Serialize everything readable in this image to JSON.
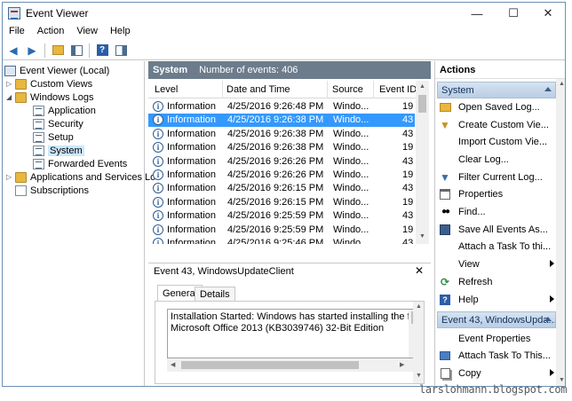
{
  "window": {
    "title": "Event Viewer"
  },
  "title_buttons": {
    "minimize": "—",
    "maximize": "☐",
    "close": "✕"
  },
  "menu": [
    "File",
    "Action",
    "View",
    "Help"
  ],
  "tree": {
    "root": "Event Viewer (Local)",
    "custom_views": "Custom Views",
    "windows_logs": "Windows Logs",
    "logs": [
      "Application",
      "Security",
      "Setup",
      "System",
      "Forwarded Events"
    ],
    "selected": "System",
    "apps_services": "Applications and Services Lo",
    "subscriptions": "Subscriptions"
  },
  "center": {
    "section": "System",
    "count_label": "Number of events: 406",
    "columns": [
      "Level",
      "Date and Time",
      "Source",
      "Event ID"
    ],
    "rows": [
      {
        "level": "Information",
        "date": "4/25/2016 9:26:48 PM",
        "source": "Windo...",
        "id": "19"
      },
      {
        "level": "Information",
        "date": "4/25/2016 9:26:38 PM",
        "source": "Windo...",
        "id": "43"
      },
      {
        "level": "Information",
        "date": "4/25/2016 9:26:38 PM",
        "source": "Windo...",
        "id": "43"
      },
      {
        "level": "Information",
        "date": "4/25/2016 9:26:38 PM",
        "source": "Windo...",
        "id": "19"
      },
      {
        "level": "Information",
        "date": "4/25/2016 9:26:26 PM",
        "source": "Windo...",
        "id": "43"
      },
      {
        "level": "Information",
        "date": "4/25/2016 9:26:26 PM",
        "source": "Windo...",
        "id": "19"
      },
      {
        "level": "Information",
        "date": "4/25/2016 9:26:15 PM",
        "source": "Windo...",
        "id": "43"
      },
      {
        "level": "Information",
        "date": "4/25/2016 9:26:15 PM",
        "source": "Windo...",
        "id": "19"
      },
      {
        "level": "Information",
        "date": "4/25/2016 9:25:59 PM",
        "source": "Windo...",
        "id": "43"
      },
      {
        "level": "Information",
        "date": "4/25/2016 9:25:59 PM",
        "source": "Windo...",
        "id": "19"
      },
      {
        "level": "Information",
        "date": "4/25/2016 9:25:46 PM",
        "source": "Windo...",
        "id": "43"
      }
    ],
    "selected_row": 1
  },
  "detail": {
    "title": "Event 43, WindowsUpdateClient",
    "tabs": [
      "General",
      "Details"
    ],
    "active_tab": "General",
    "text_line1": "Installation Started: Windows has started installing the followin",
    "text_line2": "Microsoft Office 2013 (KB3039746) 32-Bit Edition"
  },
  "actions": {
    "title": "Actions",
    "section1": "System",
    "items1": [
      "Open Saved Log...",
      "Create Custom Vie...",
      "Import Custom Vie...",
      "Clear Log...",
      "Filter Current Log...",
      "Properties",
      "Find...",
      "Save All Events As...",
      "Attach a Task To thi...",
      "View",
      "Refresh",
      "Help"
    ],
    "section2": "Event 43, WindowsUpda...",
    "items2": [
      "Event Properties",
      "Attach Task To This...",
      "Copy"
    ]
  },
  "colors": {
    "selection": "#3399ff",
    "panel_header": "#6c7c8c",
    "section": "#c7d7ea"
  },
  "watermark": "larslohmann.blogspot.com"
}
